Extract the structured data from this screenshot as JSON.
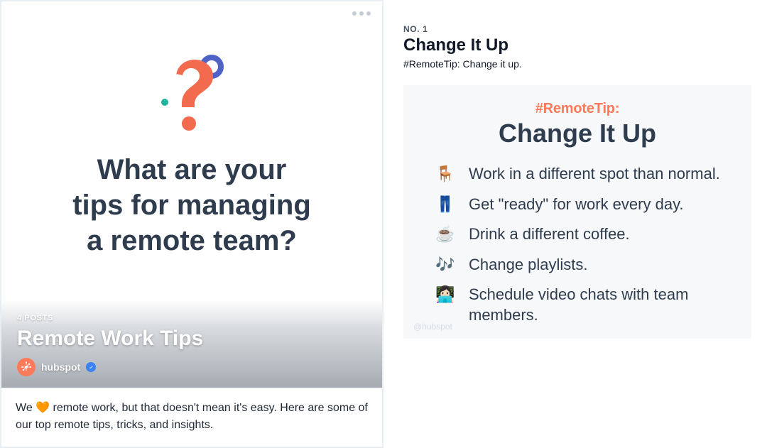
{
  "left": {
    "hero_question_l1": "What are your",
    "hero_question_l2": "tips for managing",
    "hero_question_l3": "a remote team?",
    "posts_count": "4 POSTS",
    "guide_title": "Remote Work Tips",
    "author": "hubspot",
    "description_pre": "We ",
    "description_heart": "🧡",
    "description_post": " remote work, but that doesn't mean it's easy. Here are some of our top remote tips, tricks, and insights."
  },
  "right": {
    "post_num": "NO. 1",
    "post_title": "Change It Up",
    "caption_hashtag": "#RemoteTip",
    "caption_rest": ": Change it up.",
    "tip_hashtag": "#RemoteTip:",
    "tip_heading": "Change It Up",
    "tips": [
      {
        "emoji": "🪑",
        "text": "Work in a different spot than normal."
      },
      {
        "emoji": "👖",
        "text": "Get \"ready\" for work every day."
      },
      {
        "emoji": "☕",
        "text": "Drink a different coffee."
      },
      {
        "emoji": "🎶",
        "text": "Change playlists."
      },
      {
        "emoji": "👩🏻‍💻",
        "text": "Schedule video chats with team members."
      }
    ],
    "watermark": "@hubspot"
  }
}
